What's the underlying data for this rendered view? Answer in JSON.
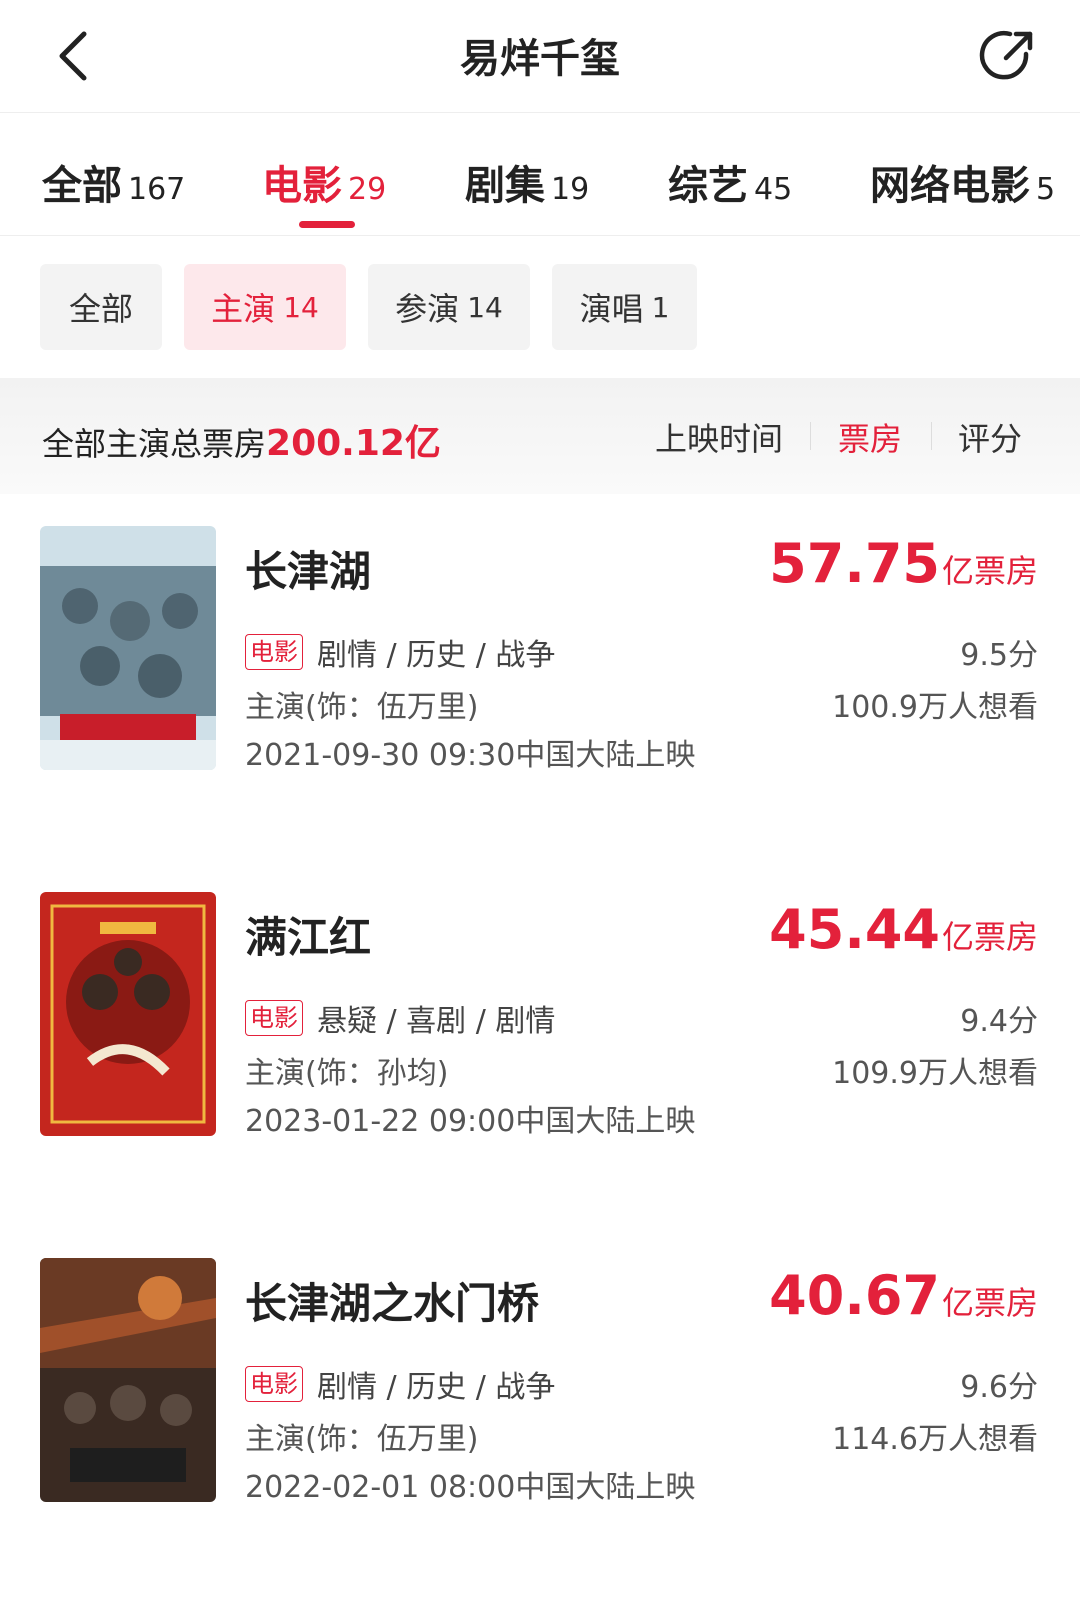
{
  "header": {
    "title": "易烊千玺",
    "back_icon": "chevron-left-icon",
    "share_icon": "share-icon"
  },
  "tabs": [
    {
      "label": "全部",
      "count": "167",
      "active": false
    },
    {
      "label": "电影",
      "count": "29",
      "active": true
    },
    {
      "label": "剧集",
      "count": "19",
      "active": false
    },
    {
      "label": "综艺",
      "count": "45",
      "active": false
    },
    {
      "label": "网络电影",
      "count": "5",
      "active": false
    }
  ],
  "filters": [
    {
      "label": "全部",
      "count": "",
      "active": false
    },
    {
      "label": "主演",
      "count": "14",
      "active": true
    },
    {
      "label": "参演",
      "count": "14",
      "active": false
    },
    {
      "label": "演唱",
      "count": "1",
      "active": false
    }
  ],
  "summary": {
    "label": "全部主演总票房",
    "total": "200.12亿",
    "sort_options": [
      {
        "label": "上映时间",
        "active": false
      },
      {
        "label": "票房",
        "active": true
      },
      {
        "label": "评分",
        "active": false
      }
    ]
  },
  "movies": [
    {
      "title": "长津湖",
      "box_office": "57.75",
      "box_unit": "亿票房",
      "badge": "电影",
      "genres": "剧情 / 历史 / 战争",
      "role": "主演(饰：伍万里)",
      "score": "9.5分",
      "wish": "100.9万人想看",
      "release": "2021-09-30 09:30中国大陆上映",
      "poster_colors": [
        "#cfe0e8",
        "#6f8a98"
      ]
    },
    {
      "title": "满江红",
      "box_office": "45.44",
      "box_unit": "亿票房",
      "badge": "电影",
      "genres": "悬疑 / 喜剧 / 剧情",
      "role": "主演(饰：孙均)",
      "score": "9.4分",
      "wish": "109.9万人想看",
      "release": "2023-01-22 09:00中国大陆上映",
      "poster_colors": [
        "#c4261e",
        "#f0b840"
      ]
    },
    {
      "title": "长津湖之水门桥",
      "box_office": "40.67",
      "box_unit": "亿票房",
      "badge": "电影",
      "genres": "剧情 / 历史 / 战争",
      "role": "主演(饰：伍万里)",
      "score": "9.6分",
      "wish": "114.6万人想看",
      "release": "2022-02-01 08:00中国大陆上映",
      "poster_colors": [
        "#3a2a22",
        "#a0502a"
      ]
    }
  ],
  "colors": {
    "accent": "#e3213b"
  }
}
